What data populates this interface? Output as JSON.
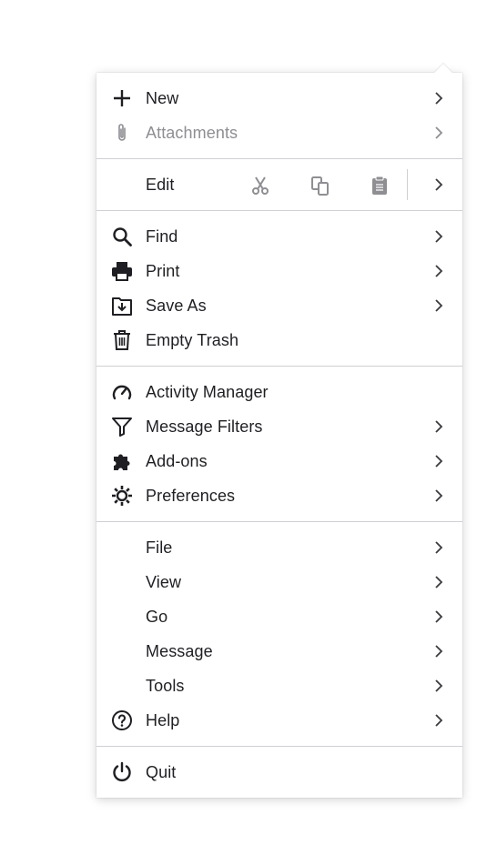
{
  "menu": {
    "new": "New",
    "attachments": "Attachments",
    "edit": "Edit",
    "edit_actions": {
      "cut": "scissors-icon",
      "copy": "copy-icon",
      "paste": "clipboard-icon"
    },
    "find": "Find",
    "print": "Print",
    "save_as": "Save As",
    "empty_trash": "Empty Trash",
    "activity_manager": "Activity Manager",
    "message_filters": "Message Filters",
    "addons": "Add-ons",
    "preferences": "Preferences",
    "file": "File",
    "view": "View",
    "go": "Go",
    "message": "Message",
    "tools": "Tools",
    "help": "Help",
    "quit": "Quit"
  },
  "colors": {
    "text": "#1f1f23",
    "disabled": "#8e8e93",
    "separator": "#cfcfd4",
    "edit_icons": "#8e8e93"
  }
}
